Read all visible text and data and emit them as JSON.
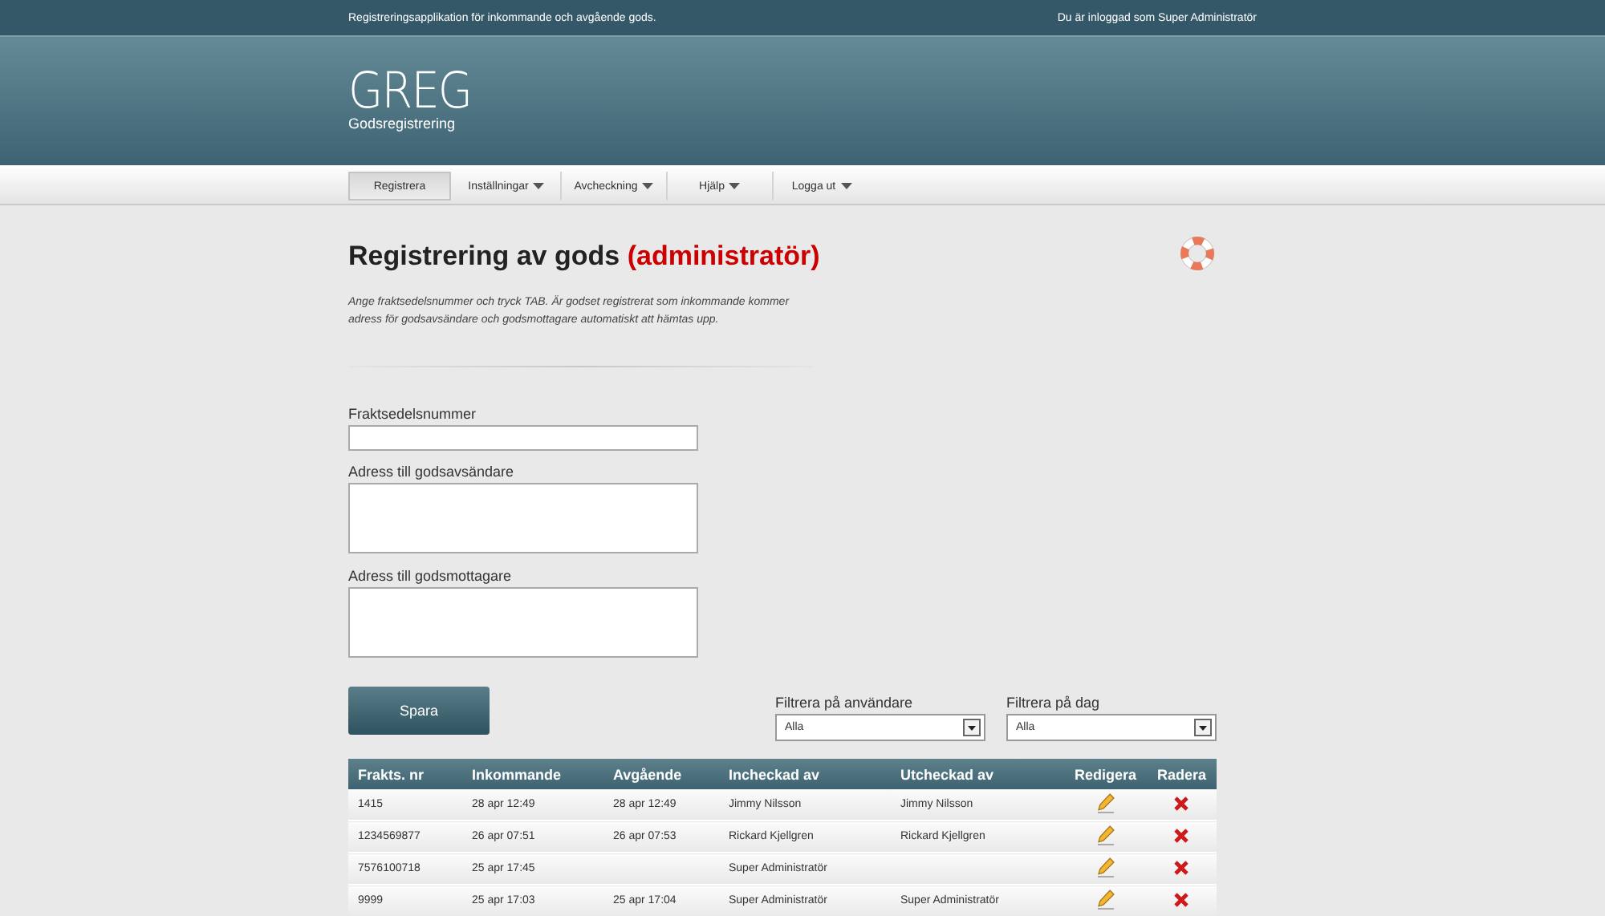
{
  "top_bar": {
    "tagline": "Registreringsapplikation för inkommande och avgående gods.",
    "user_info": "Du är inloggad som Super Administratör"
  },
  "logo": {
    "name": "GREG",
    "subtitle": "Godsregistrering"
  },
  "nav": [
    {
      "label": "Registrera",
      "selected": true,
      "dropdown": false
    },
    {
      "label": "Inställningar",
      "selected": false,
      "dropdown": true
    },
    {
      "label": "Avcheckning",
      "selected": false,
      "dropdown": true
    },
    {
      "label": "Hjälp",
      "selected": false,
      "dropdown": true
    },
    {
      "label": "Logga ut",
      "selected": false,
      "dropdown": true
    }
  ],
  "page": {
    "title": "Registrering av gods",
    "title_highlight": "(administratör)",
    "intro": "Ange fraktsedelsnummer och tryck TAB. Är godset registrerat som inkommande kommer adress för godsavsändare och godsmottagare automatiskt att hämtas upp."
  },
  "form": {
    "fields": [
      {
        "label": "Fraktsedelsnummer",
        "kind": "input"
      },
      {
        "label": "Adress till godsavsändare",
        "kind": "textarea"
      },
      {
        "label": "Adress till godsmottagare",
        "kind": "textarea"
      }
    ],
    "save_button": "Spara"
  },
  "filters": [
    {
      "label": "Filtrera på användare",
      "value": "Alla"
    },
    {
      "label": "Filtrera på dag",
      "value": "Alla"
    }
  ],
  "table": {
    "columns": [
      "Frakts. nr",
      "Inkommande",
      "Avgående",
      "Incheckad av",
      "Utcheckad av",
      "Redigera",
      "Radera"
    ],
    "rows": [
      [
        "1415",
        "28 apr 12:49",
        "28 apr 12:49",
        "Jimmy Nilsson",
        "Jimmy Nilsson"
      ],
      [
        "1234569877",
        "26 apr 07:51",
        "26 apr 07:53",
        "Rickard Kjellgren",
        "Rickard Kjellgren"
      ],
      [
        "7576100718",
        "25 apr 17:45",
        "",
        "Super Administratör",
        ""
      ],
      [
        "9999",
        "25 apr 17:03",
        "25 apr 17:04",
        "Super Administratör",
        "Super Administratör"
      ]
    ]
  }
}
